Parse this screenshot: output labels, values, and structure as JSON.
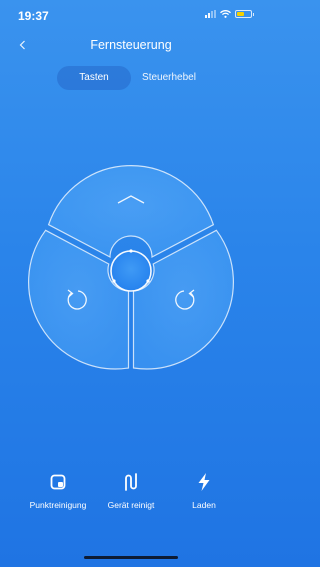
{
  "status_bar": {
    "time": "19:37"
  },
  "header": {
    "title": "Fernsteuerung"
  },
  "tabs": [
    {
      "label": "Tasten",
      "active": true
    },
    {
      "label": "Steuerhebel",
      "active": false
    }
  ],
  "remote": {
    "up_icon": "chevron-up-icon",
    "rotate_left_icon": "rotate-left-icon",
    "rotate_right_icon": "rotate-right-icon",
    "center_icon": "center-button"
  },
  "actions": [
    {
      "label": "Punktreinigung",
      "icon": "spot-clean-icon"
    },
    {
      "label": "Gerät reinigt",
      "icon": "edge-clean-icon"
    },
    {
      "label": "Laden",
      "icon": "lightning-icon"
    }
  ],
  "colors": {
    "background": "#2a84ea",
    "battery": "#f5d000",
    "center_button": "#2f8ff2"
  }
}
